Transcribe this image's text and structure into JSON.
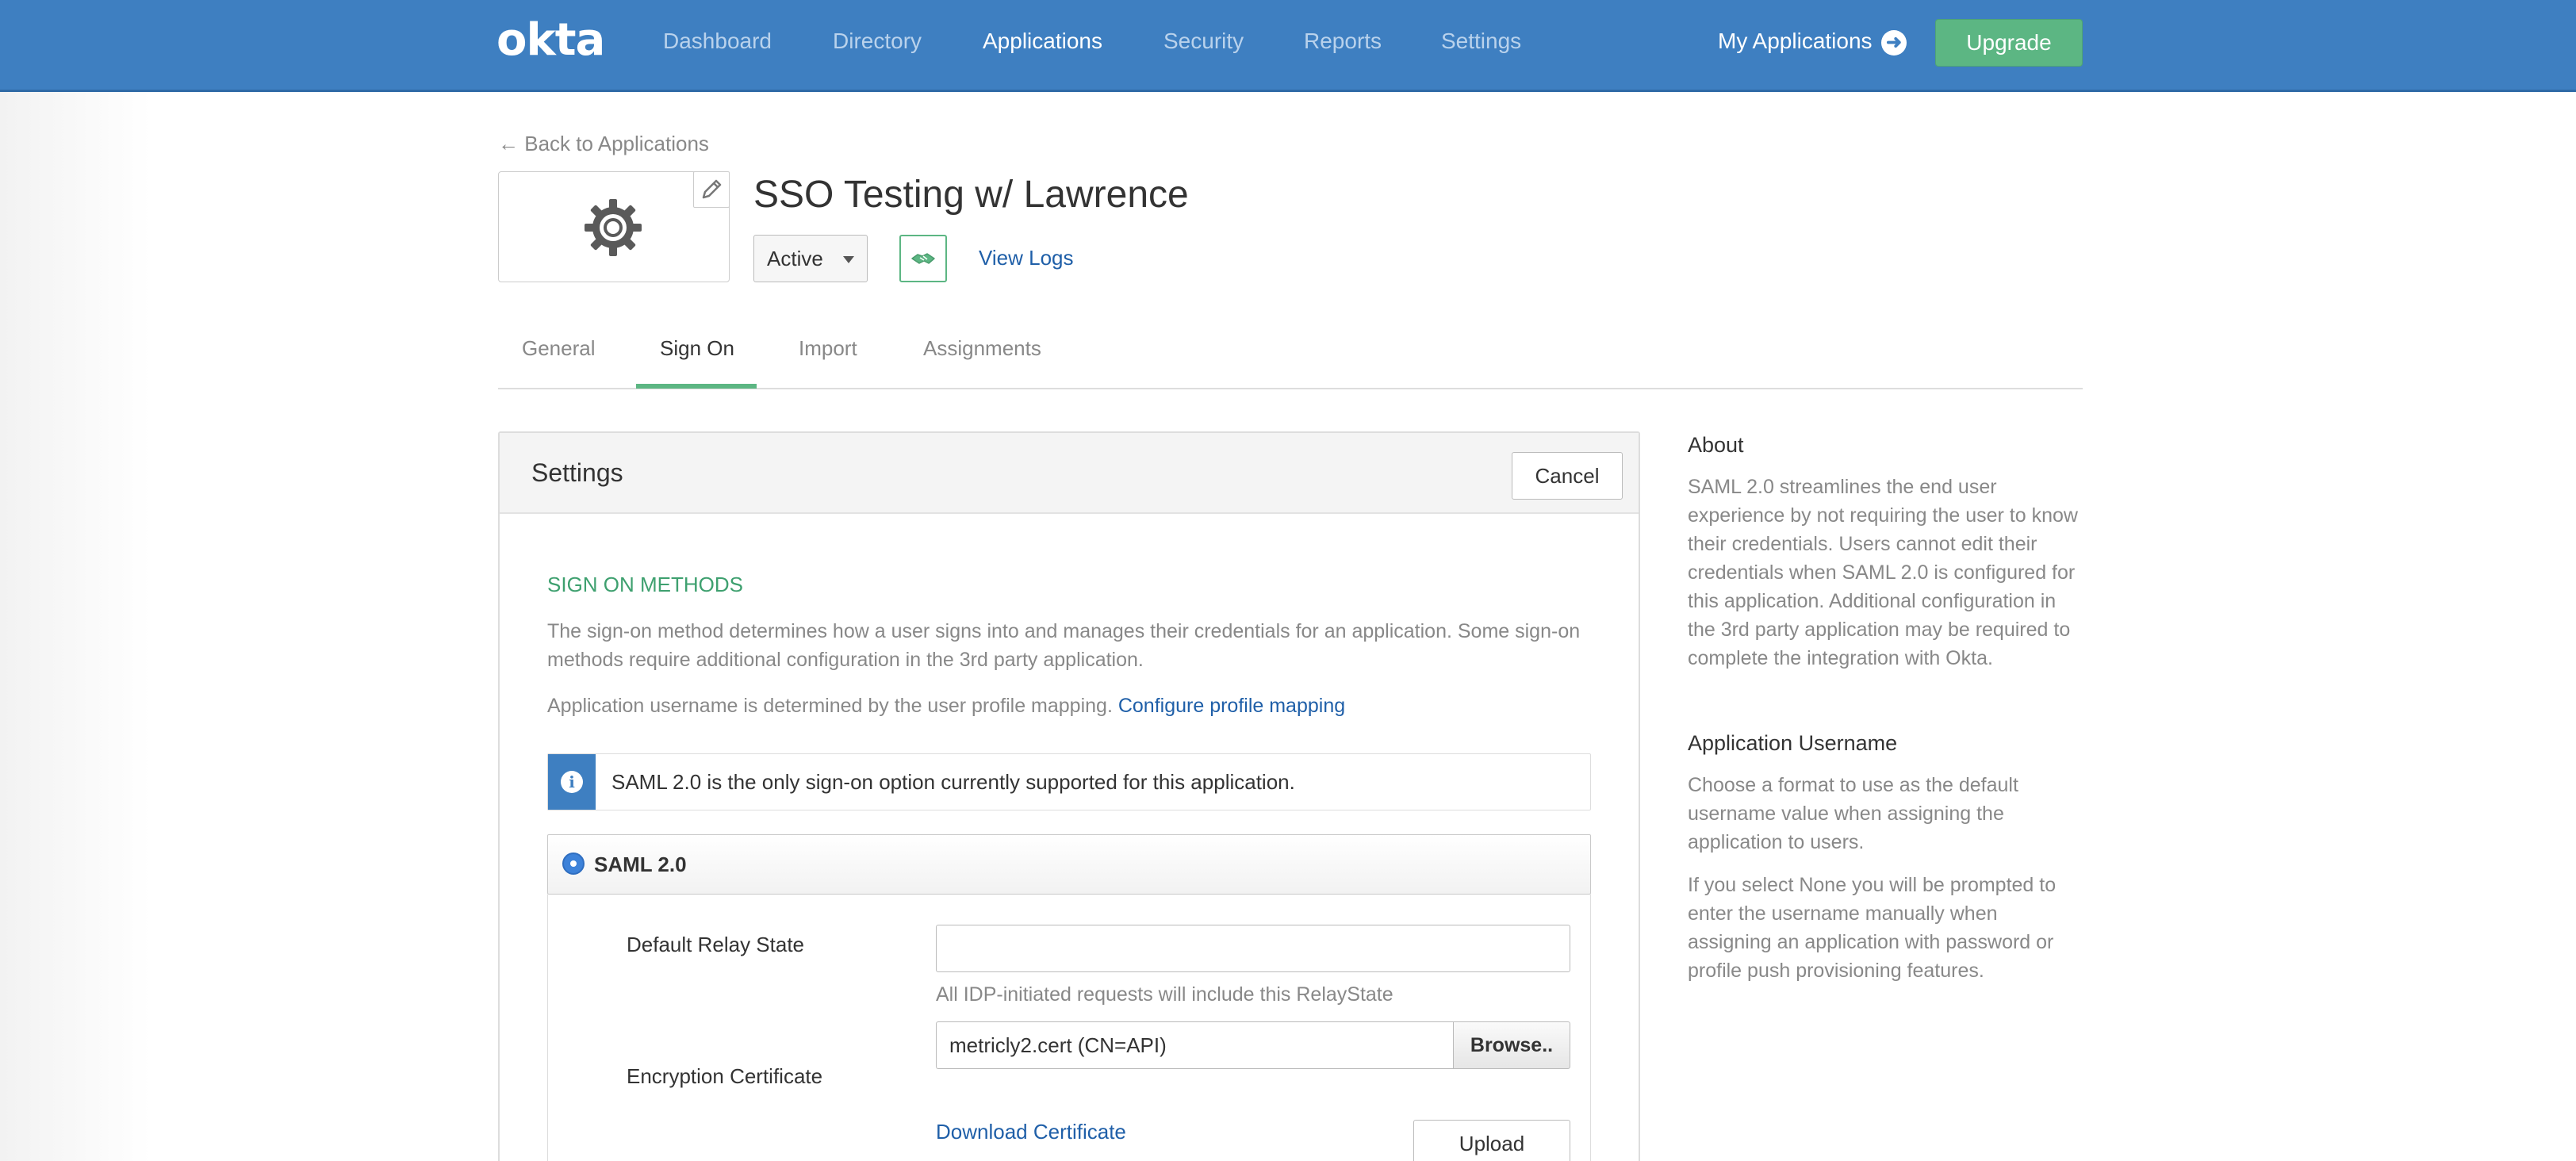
{
  "nav": {
    "logo": "okta",
    "items": [
      {
        "label": "Dashboard",
        "active": false
      },
      {
        "label": "Directory",
        "active": false
      },
      {
        "label": "Applications",
        "active": true
      },
      {
        "label": "Security",
        "active": false
      },
      {
        "label": "Reports",
        "active": false
      },
      {
        "label": "Settings",
        "active": false
      }
    ],
    "my_applications": "My Applications",
    "upgrade": "Upgrade"
  },
  "app": {
    "back_link": "← Back to Applications",
    "title": "SSO Testing w/ Lawrence",
    "status": "Active",
    "view_logs": "View Logs"
  },
  "tabs": [
    {
      "label": "General",
      "active": false
    },
    {
      "label": "Sign On",
      "active": true
    },
    {
      "label": "Import",
      "active": false
    },
    {
      "label": "Assignments",
      "active": false
    }
  ],
  "settings": {
    "title": "Settings",
    "cancel": "Cancel",
    "section_heading": "SIGN ON METHODS",
    "description": "The sign-on method determines how a user signs into and manages their credentials for an application. Some sign-on methods require additional configuration in the 3rd party application.",
    "username_note": "Application username is determined by the user profile mapping.",
    "configure_link": "Configure profile mapping",
    "info_message": "SAML 2.0 is the only sign-on option currently supported for this application.",
    "saml_option": "SAML 2.0",
    "relay_state": {
      "label": "Default Relay State",
      "value": "",
      "hint": "All IDP-initiated requests will include this RelayState"
    },
    "encryption": {
      "label": "Encryption Certificate",
      "value": "metricly2.cert (CN=API)",
      "browse": "Browse..",
      "download": "Download Certificate",
      "upload": "Upload"
    }
  },
  "sidebar": {
    "about_heading": "About",
    "about_text": "SAML 2.0 streamlines the end user experience by not requiring the user to know their credentials. Users cannot edit their credentials when SAML 2.0 is configured for this application. Additional configuration in the 3rd party application may be required to complete the integration with Okta.",
    "username_heading": "Application Username",
    "username_text": "Choose a format to use as the default username value when assigning the application to users.",
    "none_text": "If you select None you will be prompted to enter the username manually when assigning an application with password or profile push provisioning features."
  },
  "colors": {
    "nav_bg": "#3e7fc1",
    "accent_green": "#5cb683",
    "link_blue": "#1f5fa8",
    "section_green": "#3ea06f"
  },
  "icons": [
    "gear-icon",
    "pencil-icon",
    "arrow-right-circle-icon",
    "handshake-icon",
    "info-icon",
    "caret-down-icon"
  ]
}
